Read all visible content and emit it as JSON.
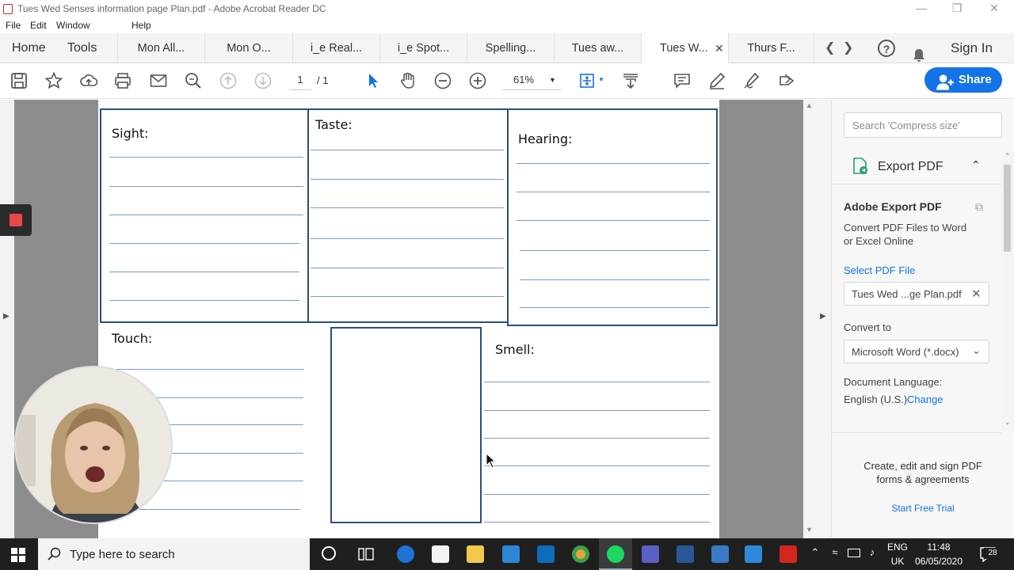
{
  "window": {
    "title": "Tues  Wed Senses information page Plan.pdf - Adobe Acrobat Reader DC"
  },
  "menu": [
    "File",
    "Edit",
    "Window",
    "Help"
  ],
  "tabs": {
    "home": "Home",
    "tools": "Tools",
    "docs": [
      "Mon All...",
      "Mon O...",
      "i_e Real...",
      "i_e Spot...",
      "Spelling...",
      "Tues aw...",
      "Tues  W...",
      "Thurs  F..."
    ],
    "active_index": 6,
    "sign_in": "Sign In"
  },
  "toolbar": {
    "page_current": "1",
    "page_total": "/ 1",
    "zoom": "61%",
    "share_label": "Share"
  },
  "document": {
    "sections": {
      "sight": "Sight:",
      "taste": "Taste:",
      "hearing": "Hearing:",
      "touch": "Touch:",
      "smell": "Smell:"
    }
  },
  "right_panel": {
    "search_placeholder": "Search 'Compress size'",
    "export_title": "Export PDF",
    "adobe_export": "Adobe Export PDF",
    "description_line1": "Convert PDF Files to Word",
    "description_line2": "or Excel Online",
    "select_file_label": "Select PDF File",
    "selected_file": "Tues Wed ...ge Plan.pdf",
    "convert_to_label": "Convert to",
    "convert_to_value": "Microsoft Word (*.docx)",
    "doc_language_label": "Document Language:",
    "doc_language_value": "English (U.S.)",
    "change_link": "Change",
    "promo_line1": "Create, edit and sign PDF",
    "promo_line2": "forms & agreements",
    "trial_link": "Start Free Trial"
  },
  "taskbar": {
    "search_placeholder": "Type here to search",
    "lang_top": "ENG",
    "lang_bottom": "UK",
    "time": "11:48",
    "date": "06/05/2020",
    "notifications": "28"
  },
  "colors": {
    "accent": "#1473e6",
    "box_border": "#2d4f7a",
    "rule": "#7b9bbf",
    "pdf_red": "#d4271b"
  }
}
